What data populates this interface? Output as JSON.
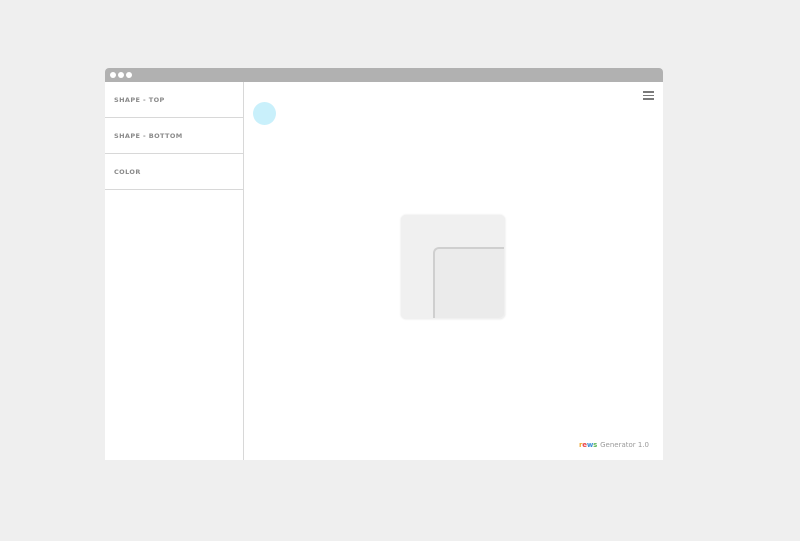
{
  "sidebar": {
    "items": [
      {
        "label": "SHAPE - TOP"
      },
      {
        "label": "SHAPE - BOTTOM"
      },
      {
        "label": "COLOR"
      }
    ]
  },
  "footer": {
    "brand_letters": [
      "r",
      "e",
      "w",
      "s"
    ],
    "generator_label": "Generator 1.0"
  },
  "colors": {
    "background": "#efefef",
    "titlebar": "#b1b1b1",
    "cursor_dot": "#c9f0fb",
    "shape_top": "#f0f0f0",
    "shape_bottom": "#ebebeb"
  },
  "icons": {
    "menu": "hamburger-menu-icon",
    "window_controls": "window-dot-icon"
  }
}
